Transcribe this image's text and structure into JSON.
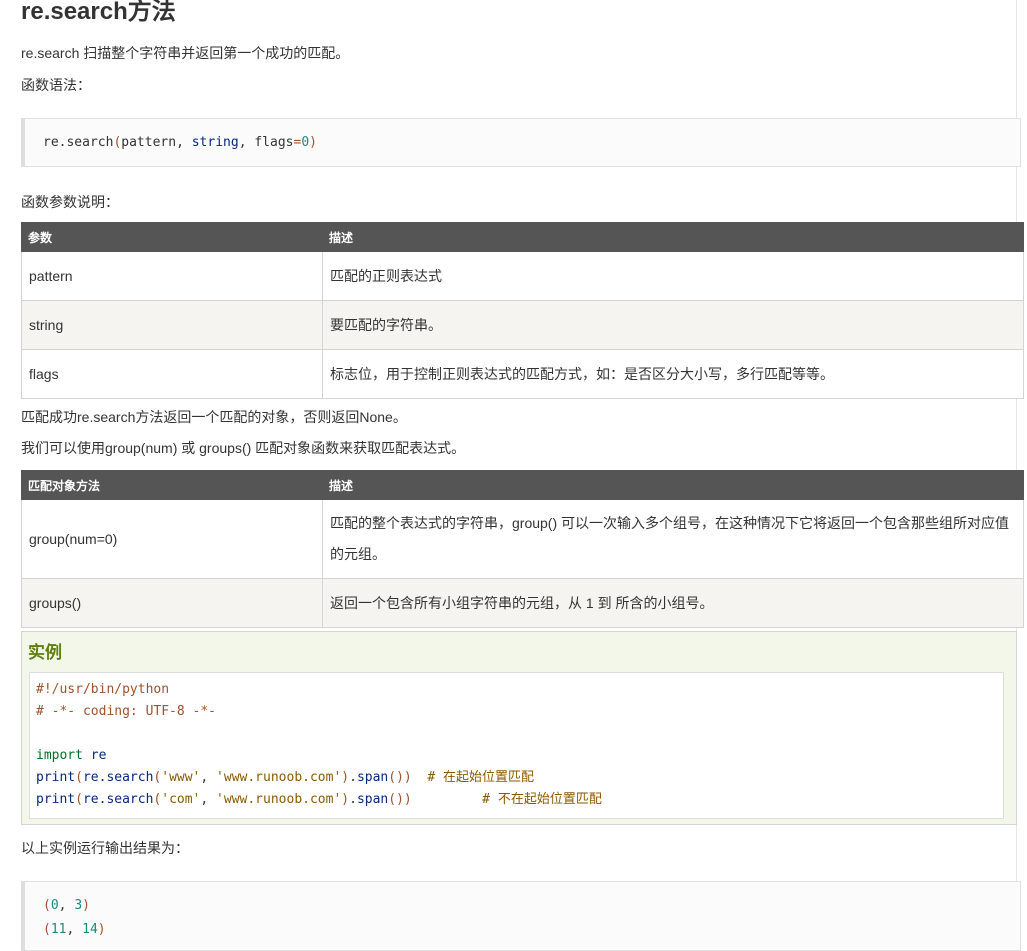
{
  "title": "re.search方法",
  "intro": "re.search 扫描整个字符串并返回第一个成功的匹配。",
  "syntax_label": "函数语法：",
  "syntax_code": {
    "fn": "re.search",
    "open": "(",
    "a1": "pattern",
    "c1": ", ",
    "a2": "string",
    "c2": ", ",
    "a3": "flags",
    "eq": "=",
    "a3v": "0",
    "close": ")"
  },
  "params_label": "函数参数说明：",
  "params_table": {
    "headers": [
      "参数",
      "描述"
    ],
    "rows": [
      [
        "pattern",
        "匹配的正则表达式"
      ],
      [
        "string",
        "要匹配的字符串。"
      ],
      [
        "flags",
        "标志位，用于控制正则表达式的匹配方式，如：是否区分大小写，多行匹配等等。"
      ]
    ]
  },
  "return_text": "匹配成功re.search方法返回一个匹配的对象，否则返回None。",
  "group_text": "我们可以使用group(num) 或 groups() 匹配对象函数来获取匹配表达式。",
  "methods_table": {
    "headers": [
      "匹配对象方法",
      "描述"
    ],
    "rows": [
      [
        "group(num=0)",
        "匹配的整个表达式的字符串，group() 可以一次输入多个组号，在这种情况下它将返回一个包含那些组所对应值的元组。"
      ],
      [
        "groups()",
        "返回一个包含所有小组字符串的元组，从 1 到 所含的小组号。"
      ]
    ]
  },
  "example": {
    "heading": "实例",
    "line1": "#!/usr/bin/python",
    "line2": "# -*- coding: UTF-8 -*-",
    "line3_kw": "import",
    "line3_mod": " re",
    "line4": {
      "print": "print",
      "p1": "(",
      "call": "re.search",
      "p2": "(",
      "s1": "'www'",
      "comma": ", ",
      "s2": "'www.runoob.com'",
      "p3": ")",
      "dot": ".",
      "span": "span",
      "p4": "())",
      "comment": "  # 在起始位置匹配"
    },
    "line5": {
      "print": "print",
      "p1": "(",
      "call": "re.search",
      "p2": "(",
      "s1": "'com'",
      "comma": ", ",
      "s2": "'www.runoob.com'",
      "p3": ")",
      "dot": ".",
      "span": "span",
      "p4": "())",
      "comment": "         # 不在起始位置匹配"
    }
  },
  "output_label": "以上实例运行输出结果为：",
  "output": {
    "l1_open": "(",
    "l1_a": "0",
    "l1_c": ", ",
    "l1_b": "3",
    "l1_close": ")",
    "l2_open": "(",
    "l2_a": "11",
    "l2_c": ", ",
    "l2_b": "14",
    "l2_close": ")"
  },
  "colors": {
    "table_header": "#555555",
    "row_alt": "#f6f4f0",
    "example_heading": "#617f10",
    "example_bg": "#f3f7ea"
  }
}
